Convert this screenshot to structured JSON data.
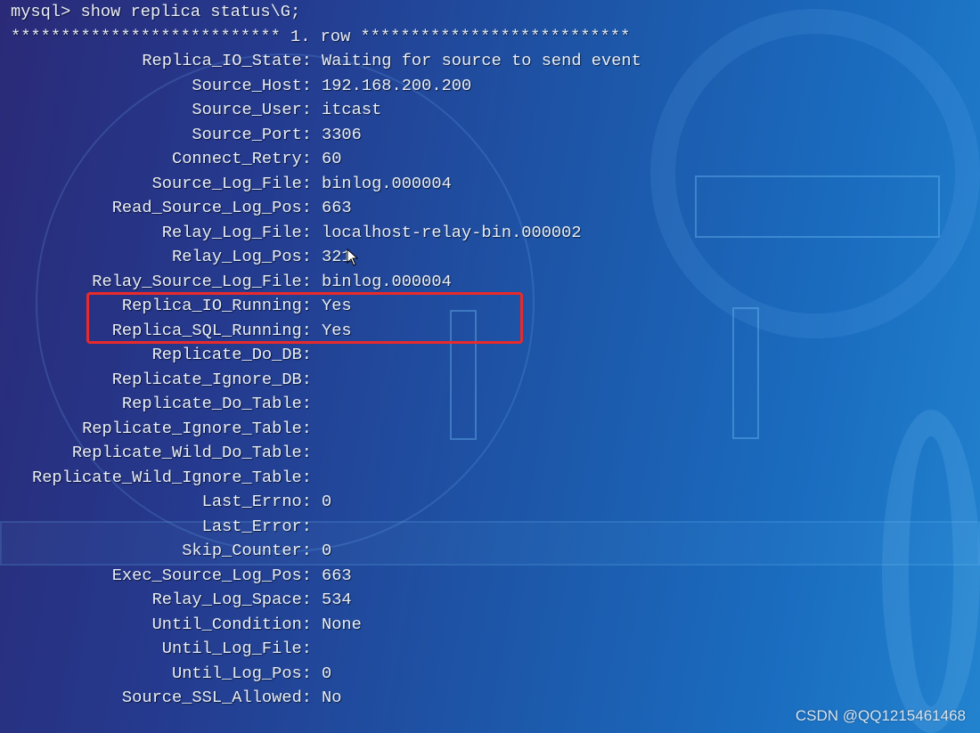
{
  "terminal": {
    "prompt": "mysql> show replica status\\G;",
    "row_header": "*************************** 1. row ***************************",
    "fields": [
      {
        "label": "Replica_IO_State",
        "value": "Waiting for source to send event"
      },
      {
        "label": "Source_Host",
        "value": "192.168.200.200"
      },
      {
        "label": "Source_User",
        "value": "itcast"
      },
      {
        "label": "Source_Port",
        "value": "3306"
      },
      {
        "label": "Connect_Retry",
        "value": "60"
      },
      {
        "label": "Source_Log_File",
        "value": "binlog.000004"
      },
      {
        "label": "Read_Source_Log_Pos",
        "value": "663"
      },
      {
        "label": "Relay_Log_File",
        "value": "localhost-relay-bin.000002"
      },
      {
        "label": "Relay_Log_Pos",
        "value": "321"
      },
      {
        "label": "Relay_Source_Log_File",
        "value": "binlog.000004"
      },
      {
        "label": "Replica_IO_Running",
        "value": "Yes"
      },
      {
        "label": "Replica_SQL_Running",
        "value": "Yes"
      },
      {
        "label": "Replicate_Do_DB",
        "value": ""
      },
      {
        "label": "Replicate_Ignore_DB",
        "value": ""
      },
      {
        "label": "Replicate_Do_Table",
        "value": ""
      },
      {
        "label": "Replicate_Ignore_Table",
        "value": ""
      },
      {
        "label": "Replicate_Wild_Do_Table",
        "value": ""
      },
      {
        "label": "Replicate_Wild_Ignore_Table",
        "value": ""
      },
      {
        "label": "Last_Errno",
        "value": "0"
      },
      {
        "label": "Last_Error",
        "value": ""
      },
      {
        "label": "Skip_Counter",
        "value": "0"
      },
      {
        "label": "Exec_Source_Log_Pos",
        "value": "663"
      },
      {
        "label": "Relay_Log_Space",
        "value": "534"
      },
      {
        "label": "Until_Condition",
        "value": "None"
      },
      {
        "label": "Until_Log_File",
        "value": ""
      },
      {
        "label": "Until_Log_Pos",
        "value": "0"
      },
      {
        "label": "Source_SSL_Allowed",
        "value": "No"
      }
    ]
  },
  "highlight_color": "#ea2a2a",
  "watermark": "CSDN @QQ1215461468"
}
